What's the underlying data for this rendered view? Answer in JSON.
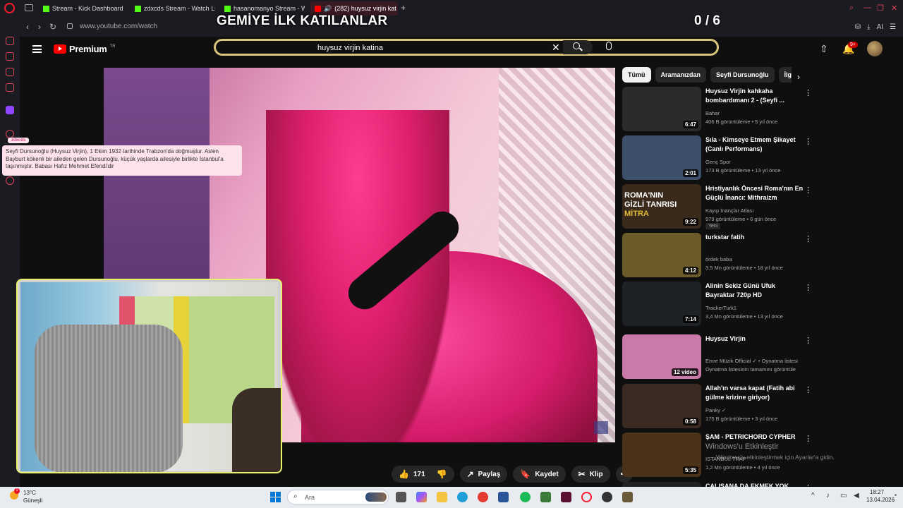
{
  "browser": {
    "tabs": [
      {
        "label": "Stream - Kick Dashboard"
      },
      {
        "label": "zdxcds Stream - Watch Li"
      },
      {
        "label": "hasanomanyo Stream - W"
      },
      {
        "label": "(282) huysuz virjin kat"
      }
    ],
    "url": "www.youtube.com/watch",
    "ai_label": "AI"
  },
  "overlay": {
    "title": "GEMİYE İLK KATILANLAR",
    "count": "0 / 6"
  },
  "youtube": {
    "logo_text": "Premium",
    "logo_region": "TR",
    "search_value": "huysuz virjin katina",
    "notif_count": "9+"
  },
  "tooltip": {
    "tag": "zdxcds",
    "text": "Seyfi Dursunoğlu (Huysuz Virjin), 1 Ekim 1932 tarihinde Trabzon'da doğmuştur. Aslen Bayburt kökenli bir aileden gelen Dursunoğlu, küçük yaşlarda ailesiyle birlikte İstanbul'a taşınmıştır. Babası Hafız Mehmet Efendi'dir"
  },
  "actions": {
    "likes": "171",
    "share": "Paylaş",
    "save": "Kaydet",
    "clip": "Klip"
  },
  "chips": [
    "Tümü",
    "Aramanızdan",
    "Seyfi Dursunoğlu",
    "İlg"
  ],
  "recommendations": [
    {
      "title": "Huysuz Virjin kahkaha bombardımanı 2 - (Seyfi ...",
      "channel": "Bahar",
      "meta": "406 B görüntüleme • 5 yıl önce",
      "duration": "6:47",
      "thumb_color": "#2b2b2b"
    },
    {
      "title": "Sıla - Kimseye Etmem Şikayet (Canlı Performans)",
      "channel": "Genç Spor",
      "meta": "173 B görüntüleme • 13 yıl önce",
      "duration": "2:01",
      "thumb_color": "#3d4f6a"
    },
    {
      "title": "Hristiyanlık Öncesi Roma'nın En Güçlü İnancı: Mithraizm",
      "channel": "Kayıp İnançlar Atlası",
      "meta": "979 görüntüleme • 6 gün önce",
      "duration": "9:22",
      "thumb_color": "#3a2a1c",
      "badge": "Yeni",
      "thumb_text_1": "ROMA'NIN",
      "thumb_text_2": "GİZLİ TANRISI",
      "thumb_text_3": "MİTRA"
    },
    {
      "title": "turkstar fatih",
      "channel": "ördek baba",
      "meta": "3,5 Mn görüntüleme • 18 yıl önce",
      "duration": "4:12",
      "thumb_color": "#6b5a2a"
    },
    {
      "title": "Alinin Sekiz Günü Ufuk Bayraktar 720p HD",
      "channel": "TrackerTurk1",
      "meta": "3,4 Mn görüntüleme • 13 yıl önce",
      "duration": "7:14",
      "thumb_color": "#1e2126"
    },
    {
      "title": "Huysuz Virjin",
      "channel": "Emre Müzik Official ✓ • Oynatma listesi",
      "meta": "Oynatma listesinin tamamını görüntüle",
      "duration": "12 video",
      "thumb_color": "#c97aa8"
    },
    {
      "title": "Allah'ın varsa kapat (Fatih abi gülme krizine giriyor)",
      "channel": "Panky ✓",
      "meta": "175 B görüntüleme • 3 yıl önce",
      "duration": "0:58",
      "thumb_color": "#3b2a22"
    },
    {
      "title": "ŞAM - PETRICHORD CYPHER",
      "channel": "ISTANBUL TRAP",
      "meta": "1,2 Mn görüntüleme • 4 yıl önce",
      "duration": "5:35",
      "thumb_color": "#4a3218"
    },
    {
      "title": "ÇALIŞANA DA EKMEK YOK",
      "channel": "",
      "meta": "",
      "duration": "",
      "thumb_color": "#222"
    }
  ],
  "windows": {
    "activate_title": "Windows'u Etkinleştir",
    "activate_sub": "Windows'u etkinleştirmek için Ayarlar'a gidin.",
    "temp": "13°C",
    "weather": "Güneşli",
    "weather_badge": "1",
    "search_placeholder": "Ara",
    "time": "18:27",
    "date": "13.04.2026"
  },
  "colors": {
    "accent": "#ff0000",
    "search_border": "#d8c57a",
    "webcam_border": "#e7f16a",
    "tooltip_bg": "#fde2ec"
  }
}
